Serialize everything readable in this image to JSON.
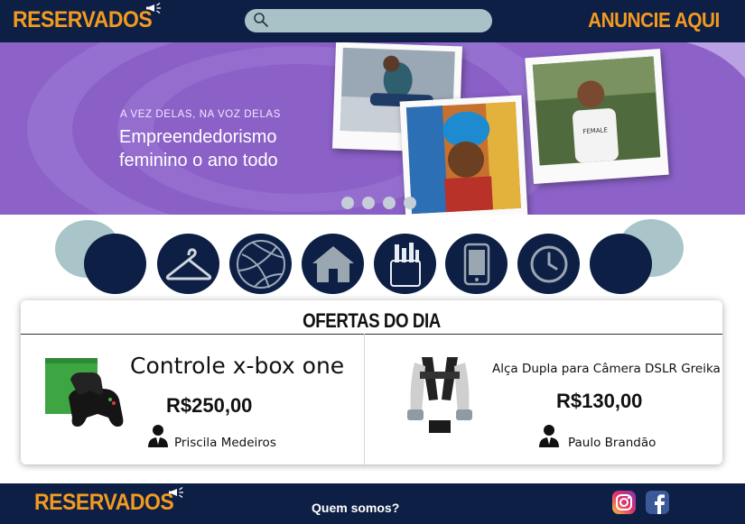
{
  "header": {
    "logo": "RESERVADOS",
    "search": {
      "placeholder": ""
    },
    "advertise_link": "ANUNCIE AQUI"
  },
  "banner": {
    "kicker": "A VEZ DELAS, NA VOZ DELAS",
    "title_line1": "Empreendedorismo",
    "title_line2": "feminino o ano todo",
    "slides_count": 4
  },
  "categories": [
    {
      "icon": "blank-icon"
    },
    {
      "icon": "hanger-icon"
    },
    {
      "icon": "volleyball-icon"
    },
    {
      "icon": "house-icon"
    },
    {
      "icon": "school-supplies-icon"
    },
    {
      "icon": "smartphone-icon"
    },
    {
      "icon": "clock-icon"
    },
    {
      "icon": "blank-icon"
    }
  ],
  "offers": {
    "title": "OFERTAS DO DIA",
    "items": [
      {
        "name": "Controle x-box one",
        "price": "R$250,00",
        "seller": "Priscila Medeiros",
        "image": "xbox-controller-image"
      },
      {
        "name": "Alça Dupla para Câmera DSLR Greika",
        "price": "R$130,00",
        "seller": "Paulo Brandão",
        "image": "camera-strap-image"
      }
    ]
  },
  "footer": {
    "logo": "RESERVADOS",
    "about_link": "Quem somos?",
    "social": [
      {
        "icon": "instagram-icon"
      },
      {
        "icon": "facebook-icon"
      }
    ]
  },
  "colors": {
    "navy": "#0d1f45",
    "orange": "#f39a1f",
    "teal_light": "#a9c5c9",
    "banner_purple": "#8a5fc6"
  }
}
